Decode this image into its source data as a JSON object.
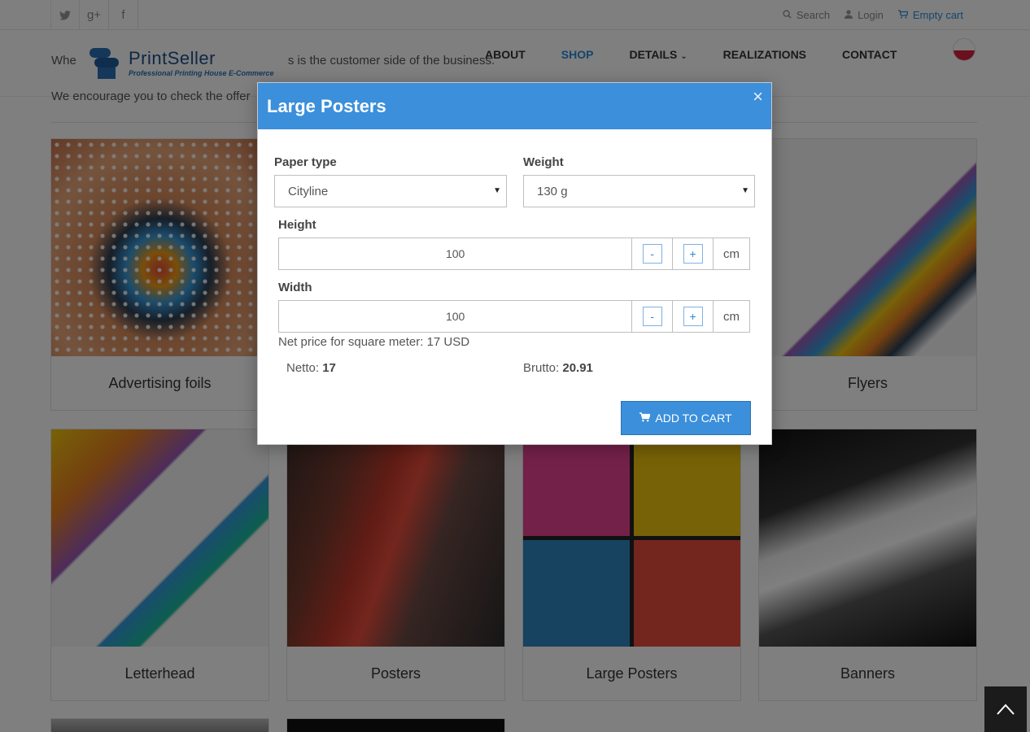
{
  "topbar": {
    "social": [
      {
        "icon": "twitter-icon",
        "glyph": "🐦"
      },
      {
        "icon": "google-plus-icon",
        "glyph": "g+"
      },
      {
        "icon": "facebook-icon",
        "glyph": "f"
      }
    ],
    "search_label": "Search",
    "login_label": "Login",
    "cart_label": "Empty cart"
  },
  "header": {
    "logo_name": "PrintSeller",
    "logo_tagline": "Professional Printing House E-Commerce",
    "nav": [
      "ABOUT",
      "SHOP",
      "DETAILS",
      "REALIZATIONS",
      "CONTACT"
    ],
    "active_nav": "SHOP",
    "language_flag": "poland-flag-icon"
  },
  "intro": {
    "line1_start": "Whe",
    "line1_end": "s is the customer side of the business.",
    "line2": "We encourage you to check the offer"
  },
  "products": [
    {
      "label": "Advertising foils",
      "image": "eye"
    },
    {
      "label": "",
      "image": "hidden"
    },
    {
      "label": "",
      "image": "hidden"
    },
    {
      "label": "Flyers",
      "image": "flyers"
    },
    {
      "label": "Letterhead",
      "image": "letterhead"
    },
    {
      "label": "Posters",
      "image": "posters"
    },
    {
      "label": "Large Posters",
      "image": "large-posters"
    },
    {
      "label": "Banners",
      "image": "banners"
    }
  ],
  "modal": {
    "title": "Large Posters",
    "close_glyph": "×",
    "paper_type_label": "Paper type",
    "paper_type_value": "Cityline",
    "weight_label": "Weight",
    "weight_value": "130 g",
    "height_label": "Height",
    "height_value": "100",
    "width_label": "Width",
    "width_value": "100",
    "minus_glyph": "-",
    "plus_glyph": "+",
    "unit": "cm",
    "net_price_text": "Net price for square meter: 17 USD",
    "netto_label": "Netto:",
    "netto_value": "17",
    "brutto_label": "Brutto:",
    "brutto_value": "20.91",
    "add_to_cart_label": "ADD TO CART"
  },
  "colors": {
    "accent": "#3b8fdb",
    "nav_active": "#2a8bd8"
  }
}
